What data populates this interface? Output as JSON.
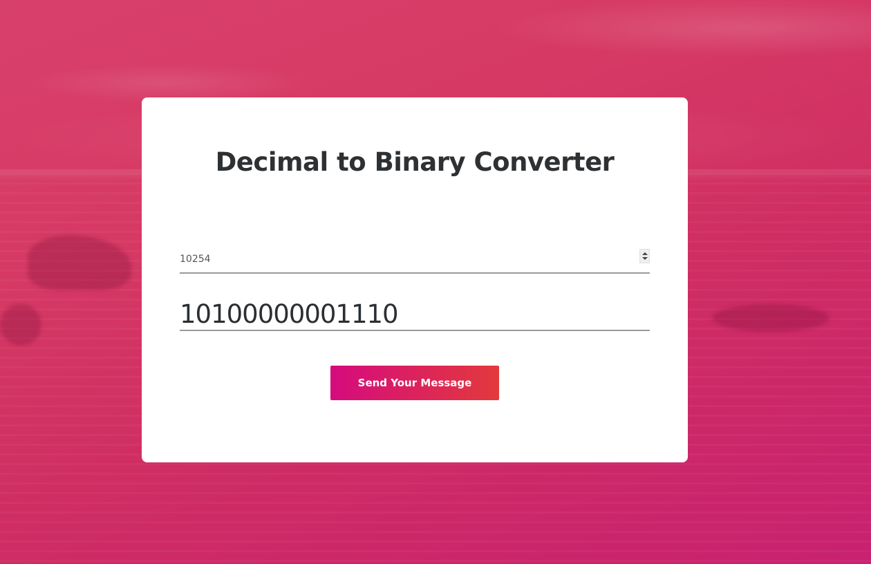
{
  "converter": {
    "title": "Decimal to Binary Converter",
    "decimal_value": "10254",
    "binary_result": "10100000001110",
    "submit_label": "Send Your Message"
  },
  "colors": {
    "background_accent": "#d63a64",
    "card_background": "#ffffff",
    "title_text": "#2e3134",
    "button_gradient_start": "#d50b7e",
    "button_gradient_end": "#e23a3c",
    "underline": "#9a9a9a"
  },
  "icons": {
    "spinner": "spinner-arrows-icon"
  }
}
